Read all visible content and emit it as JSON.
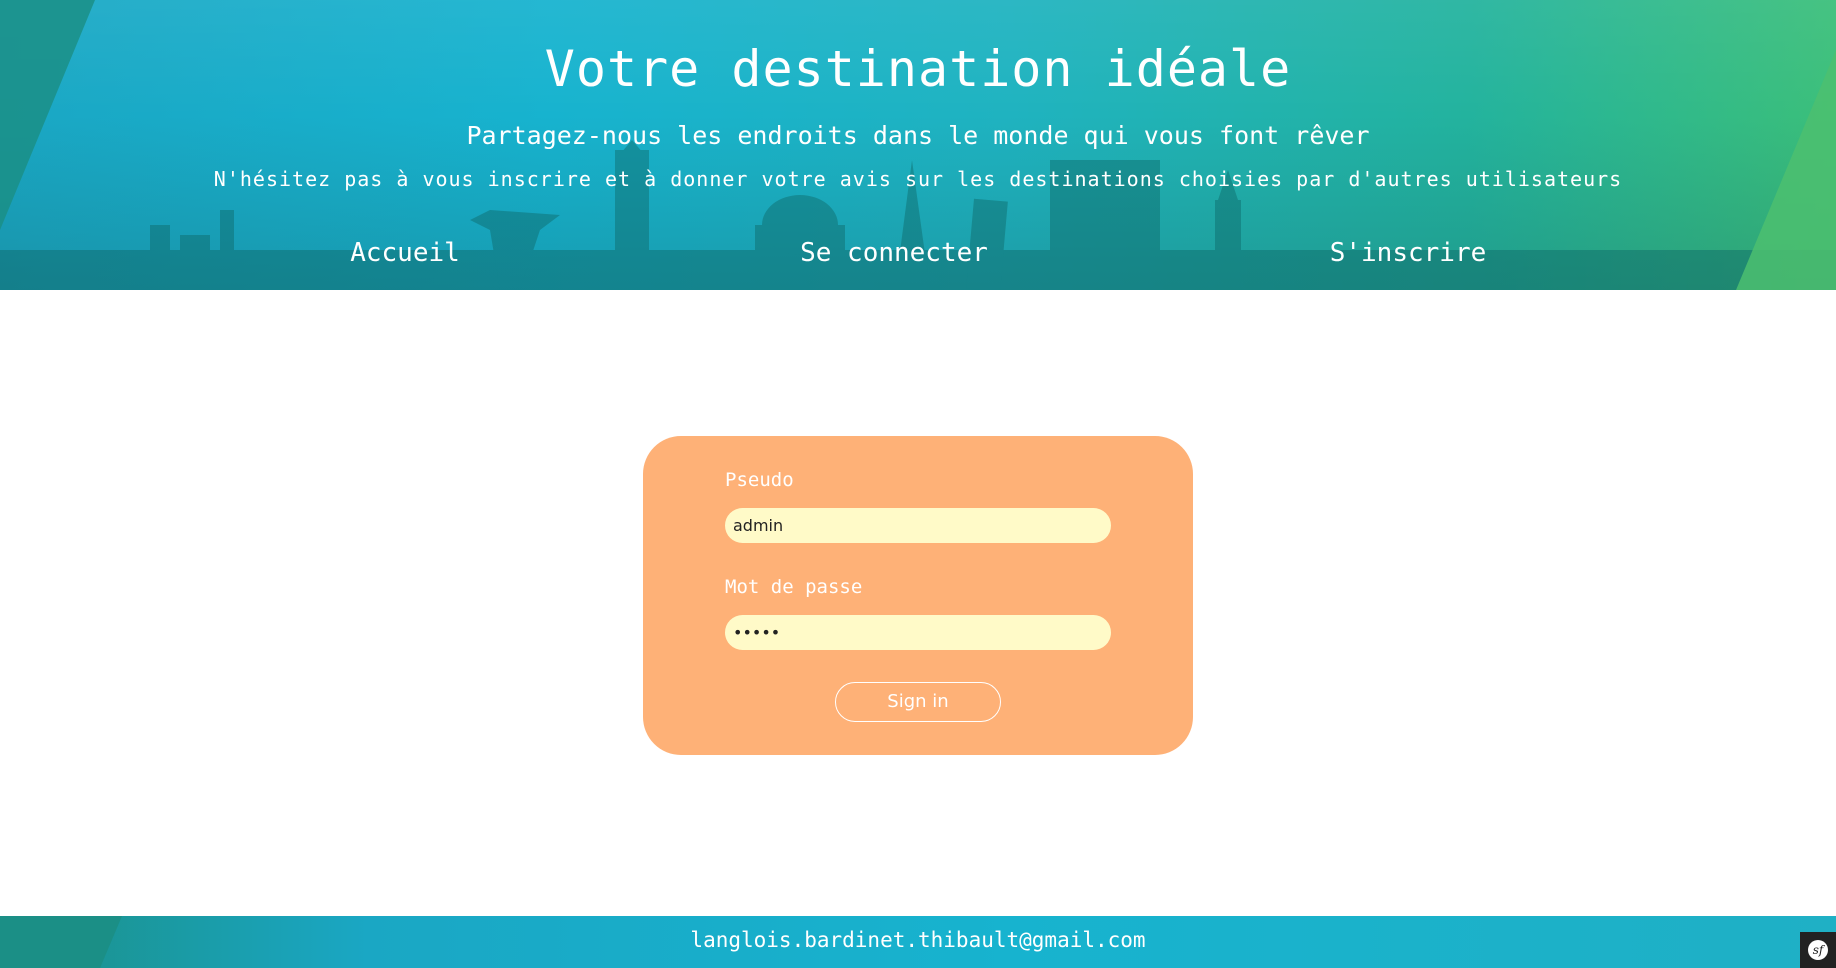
{
  "header": {
    "title": "Votre destination idéale",
    "subtitle": "Partagez-nous les endroits dans le monde qui vous font rêver",
    "tagline": "N'hésitez pas à vous inscrire et à donner votre avis sur les destinations choisies par d'autres utilisateurs"
  },
  "nav": {
    "home": "Accueil",
    "login": "Se connecter",
    "register": "S'inscrire"
  },
  "login_form": {
    "username_label": "Pseudo",
    "username_value": "admin",
    "password_label": "Mot de passe",
    "password_value": "•••••",
    "submit_label": "Sign in"
  },
  "footer": {
    "email": "langlois.bardinet.thibault@gmail.com"
  },
  "icons": {
    "debug_toolbar": "symfony-icon"
  },
  "colors": {
    "form_background": "#feb177",
    "input_background": "#fffac8",
    "header_teal": "#17b3cf",
    "header_green": "#3bbf7a"
  }
}
